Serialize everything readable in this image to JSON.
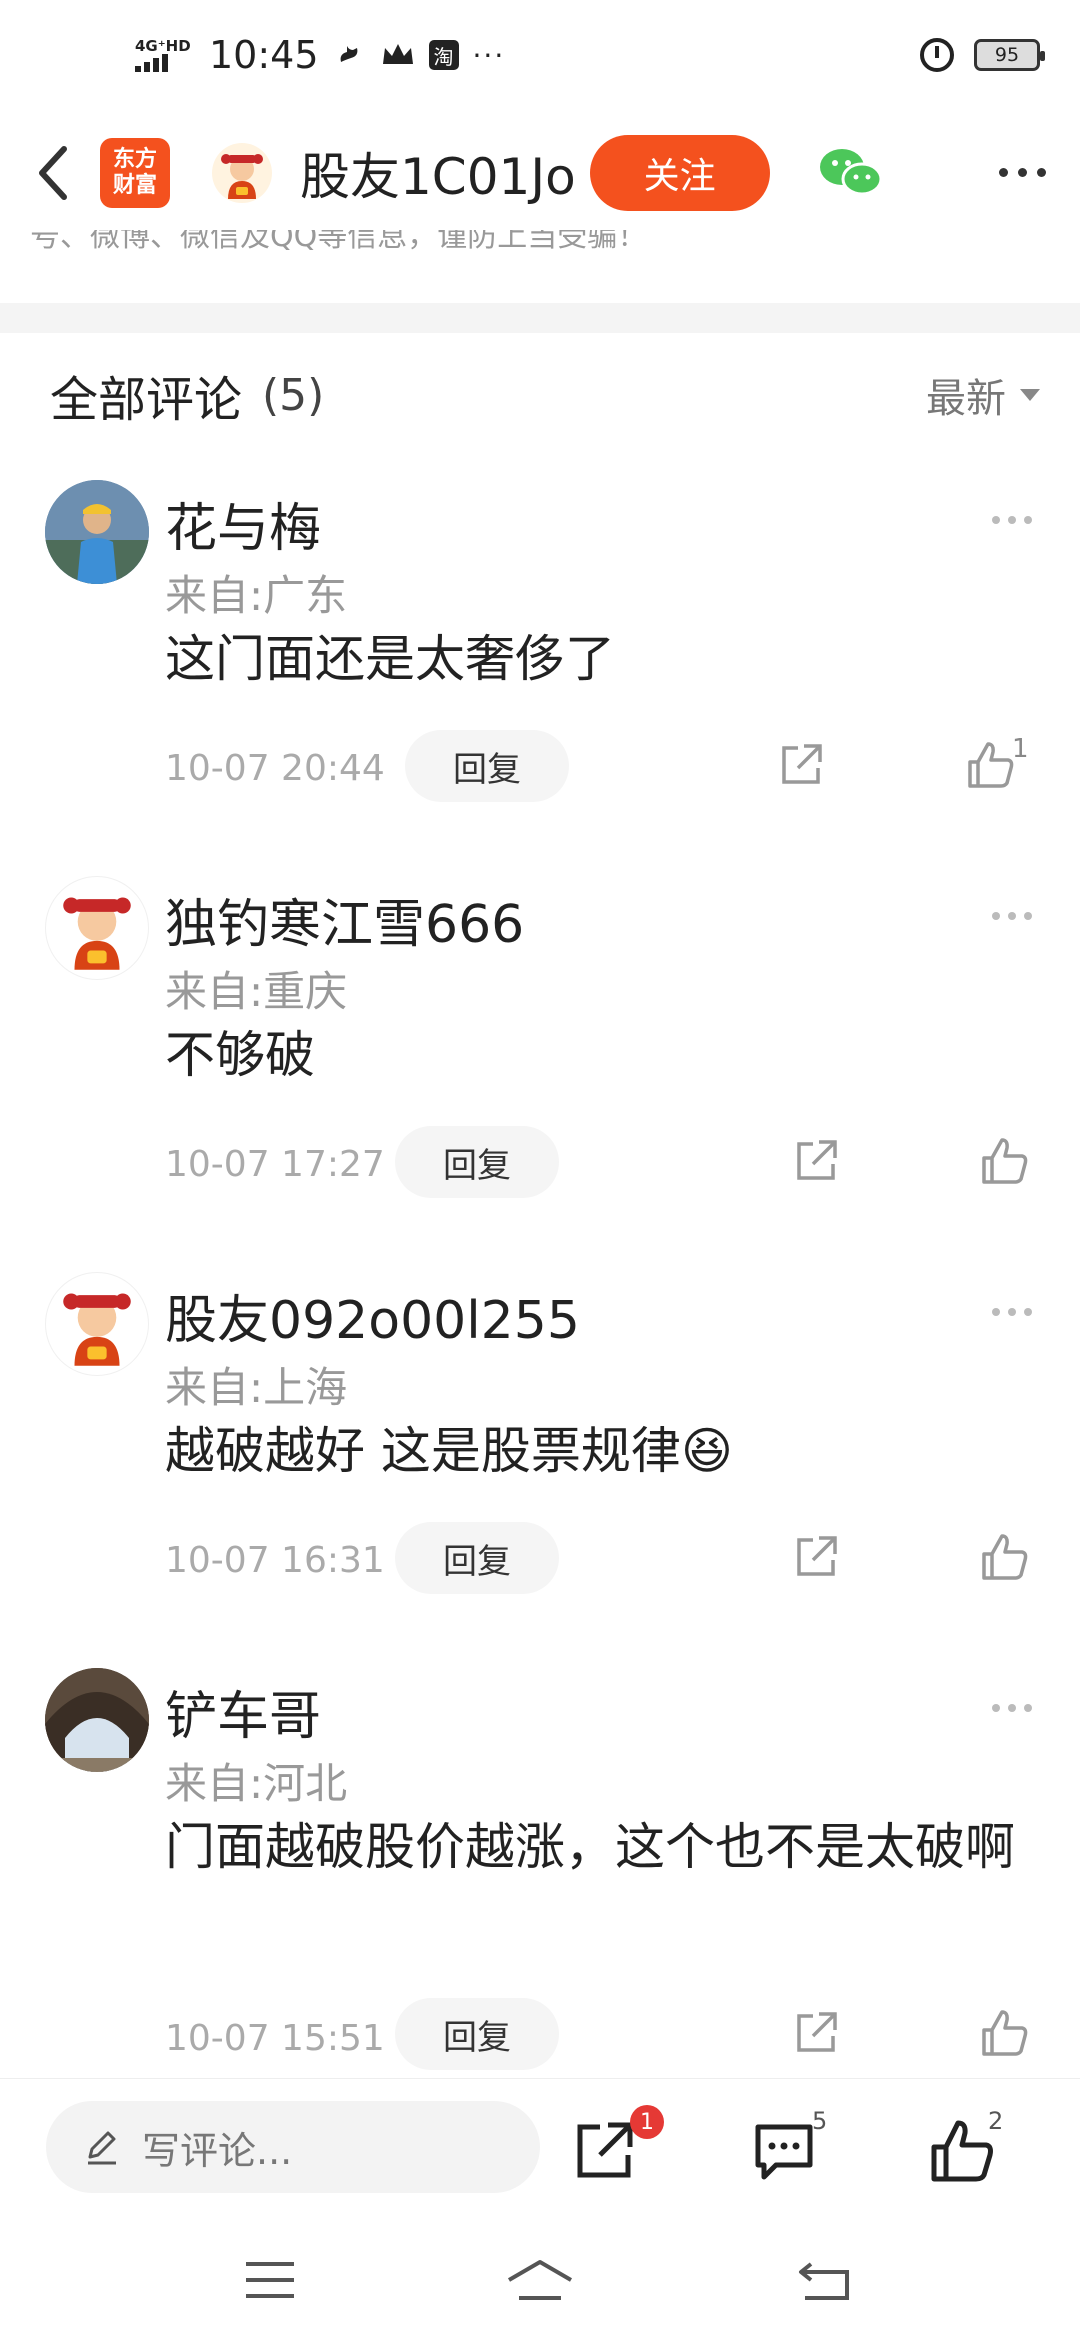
{
  "status_bar": {
    "network": "4G⁺HD",
    "time": "10:45",
    "battery": "95"
  },
  "nav": {
    "brand_line1": "东方",
    "brand_line2": "财富",
    "title": "股友1C01Jo",
    "follow_label": "关注"
  },
  "notice": "号、微博、微信及QQ等信息，谨防上当受骗！",
  "comments_header": {
    "title": "全部评论",
    "count": "(5)",
    "sort_label": "最新"
  },
  "comments": [
    {
      "name": "花与梅",
      "location": "来自:广东",
      "text": "这门面还是太奢侈了",
      "time": "10-07 20:44",
      "reply_label": "回复",
      "like_count": "1"
    },
    {
      "name": "独钓寒江雪666",
      "location": "来自:重庆",
      "text": "不够破",
      "time": "10-07 17:27",
      "reply_label": "回复",
      "like_count": ""
    },
    {
      "name": "股友092o00l255",
      "location": "来自:上海",
      "text": "越破越好 这是股票规律",
      "emoji": "😆",
      "time": "10-07 16:31",
      "reply_label": "回复",
      "like_count": ""
    },
    {
      "name": "铲车哥",
      "location": "来自:河北",
      "text": "门面越破股价越涨，这个也不是太破啊",
      "time": "10-07 15:51",
      "reply_label": "回复",
      "like_count": ""
    }
  ],
  "bottom_bar": {
    "input_placeholder": "写评论...",
    "share_badge": "1",
    "comment_count": "5",
    "like_count": "2"
  },
  "colors": {
    "accent": "#f4511e",
    "wechat": "#4cc75a",
    "badge": "#e53935"
  }
}
